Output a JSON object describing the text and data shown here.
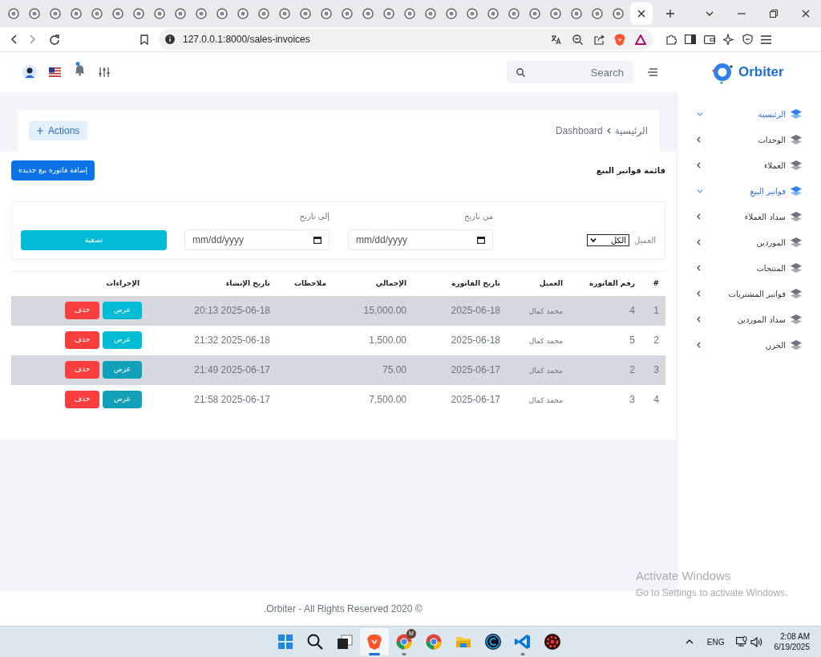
{
  "browser": {
    "tabs": [
      {
        "selected": false
      },
      {
        "selected": false
      },
      {
        "selected": false
      },
      {
        "selected": false
      },
      {
        "selected": false
      },
      {
        "selected": false
      },
      {
        "selected": false
      },
      {
        "selected": false
      },
      {
        "selected": false
      },
      {
        "selected": false
      },
      {
        "selected": false
      },
      {
        "selected": false
      },
      {
        "selected": false
      },
      {
        "selected": false
      },
      {
        "selected": false
      },
      {
        "selected": false
      },
      {
        "selected": false
      },
      {
        "selected": false
      },
      {
        "selected": false
      },
      {
        "selected": false
      },
      {
        "selected": false
      },
      {
        "selected": false
      },
      {
        "selected": false
      },
      {
        "selected": false
      },
      {
        "selected": false
      },
      {
        "selected": false
      },
      {
        "selected": false
      },
      {
        "selected": false
      },
      {
        "selected": false
      },
      {
        "selected": false
      },
      {
        "selected": true
      }
    ],
    "url": "127.0.0.1:8000/sales-invoices"
  },
  "header": {
    "brand": "Orbiter",
    "search": {
      "placeholder": "Search"
    }
  },
  "breadcrumb": [
    "الرئيسية",
    "Dashboard"
  ],
  "actions_button": "Actions",
  "sidebar": {
    "items": [
      {
        "label": "الرئيسية",
        "selected": true,
        "expanded": true
      },
      {
        "label": "الوحدات",
        "selected": false,
        "expanded": false
      },
      {
        "label": "العملاء",
        "selected": false,
        "expanded": false
      },
      {
        "label": "فواتير البيع",
        "selected": true,
        "expanded": true
      },
      {
        "label": "سداد العملاء",
        "selected": false,
        "expanded": false
      },
      {
        "label": "الموردين",
        "selected": false,
        "expanded": false
      },
      {
        "label": "المنتجات",
        "selected": false,
        "expanded": false
      },
      {
        "label": "فواتير المشتريات",
        "selected": false,
        "expanded": false
      },
      {
        "label": "سداد الموردين",
        "selected": false,
        "expanded": false
      },
      {
        "label": "الخزن",
        "selected": false,
        "expanded": false
      }
    ]
  },
  "page_title": "قائمة فواتير البيع",
  "add_button": "إضافة فاتوره بيع جديده",
  "filters": {
    "customer_label": "العميل",
    "customer_value": "الكل",
    "from_label": "من تاريخ",
    "from_placeholder": "mm/dd/yyyy",
    "to_label": "إلى تاريخ",
    "to_placeholder": "mm/dd/yyyy",
    "filter_button": "تصفية"
  },
  "table": {
    "columns": [
      "#",
      "رقم الفاتورة",
      "العميل",
      "تاريخ الفاتورة",
      "الإجمالي",
      "ملاحظات",
      "تاريخ الإنشاء",
      "الإجراءات"
    ],
    "rows": [
      {
        "shaded": true,
        "cells": [
          "1",
          "4",
          "محمد كمال",
          "2025-06-18",
          "15,000.00",
          "",
          "20:13 2025-06-18"
        ],
        "view": {
          "label": "عرض",
          "highlighted": false
        },
        "delete": "حذف"
      },
      {
        "shaded": false,
        "cells": [
          "2",
          "5",
          "محمد كمال",
          "2025-06-18",
          "1,500.00",
          "",
          "21:32 2025-06-18"
        ],
        "view": {
          "label": "عرض",
          "highlighted": false
        },
        "delete": "حذف"
      },
      {
        "shaded": true,
        "cells": [
          "3",
          "2",
          "محمد كمال",
          "2025-06-17",
          "75.00",
          "",
          "21:49 2025-06-17"
        ],
        "view": {
          "label": "عرض",
          "highlighted": true
        },
        "delete": "حذف"
      },
      {
        "shaded": false,
        "cells": [
          "4",
          "3",
          "محمد كمال",
          "2025-06-17",
          "7,500.00",
          "",
          "21:58 2025-06-17"
        ],
        "view": {
          "label": "عرض",
          "highlighted": true
        },
        "delete": "حذف"
      }
    ]
  },
  "footer": ".Orbiter - All Rights Reserved 2020 ©",
  "os_notice": {
    "title": "Activate Windows",
    "text": "Go to Settings to activate Windows."
  },
  "taskbar": {
    "apps": [
      {
        "kind": "start",
        "running": false,
        "selected": false
      },
      {
        "kind": "search",
        "running": false,
        "selected": false
      },
      {
        "kind": "taskview",
        "running": false,
        "selected": false
      },
      {
        "kind": "brave",
        "running": true,
        "selected": true
      },
      {
        "kind": "chrome",
        "running": true,
        "selected": false,
        "badge": "M"
      },
      {
        "kind": "chrome",
        "running": false,
        "selected": false
      },
      {
        "kind": "folder",
        "running": false,
        "selected": false
      },
      {
        "kind": "cleaner",
        "running": false,
        "selected": false
      },
      {
        "kind": "vscode",
        "running": true,
        "selected": false
      },
      {
        "kind": "gear",
        "running": false,
        "selected": false
      }
    ],
    "language": "ENG",
    "time": "2:08 AM",
    "date": "6/19/2025"
  }
}
